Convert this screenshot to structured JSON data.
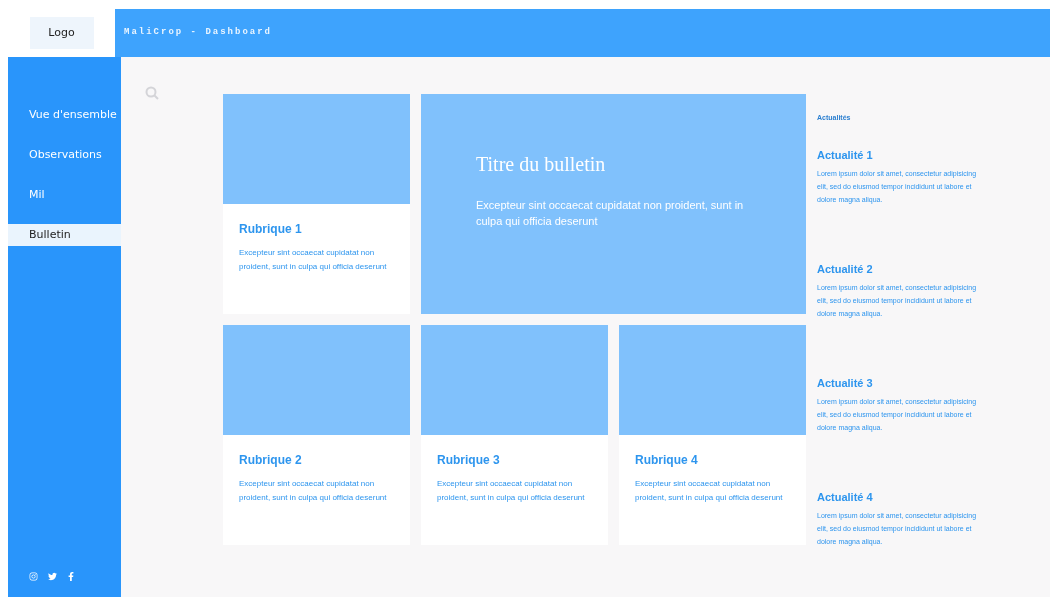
{
  "logo": "Logo",
  "header": {
    "title": "MaliCrop - Dashboard"
  },
  "sidebar": {
    "items": [
      {
        "label": "Vue d'ensemble",
        "selected": false
      },
      {
        "label": "Observations",
        "selected": false
      },
      {
        "label": "Mil",
        "selected": false
      },
      {
        "label": "Bulletin",
        "selected": true
      }
    ]
  },
  "bulletin": {
    "title": "Titre du bulletin",
    "text": "Excepteur sint occaecat cupidatat non proident, sunt in culpa qui officia deserunt"
  },
  "rubriques": [
    {
      "title": "Rubrique 1",
      "text": "Excepteur sint occaecat cupidatat non proident, sunt in culpa qui officia deserunt"
    },
    {
      "title": "Rubrique 2",
      "text": "Excepteur sint occaecat cupidatat non proident, sunt in culpa qui officia deserunt"
    },
    {
      "title": "Rubrique 3",
      "text": "Excepteur sint occaecat cupidatat non proident, sunt in culpa qui officia deserunt"
    },
    {
      "title": "Rubrique 4",
      "text": "Excepteur sint occaecat cupidatat non proident, sunt in culpa qui officia deserunt"
    }
  ],
  "news": {
    "heading": "Actualités",
    "items": [
      {
        "title": "Actualité 1",
        "text": "Lorem ipsum dolor sit amet, consectetur adipisicing elit, sed do eiusmod tempor incididunt ut labore et dolore magna aliqua."
      },
      {
        "title": "Actualité 2",
        "text": "Lorem ipsum dolor sit amet, consectetur adipisicing elit, sed do eiusmod tempor incididunt ut labore et dolore magna aliqua."
      },
      {
        "title": "Actualité 3",
        "text": "Lorem ipsum dolor sit amet, consectetur adipisicing elit, sed do eiusmod tempor incididunt ut labore et dolore magna aliqua."
      },
      {
        "title": "Actualité 4",
        "text": "Lorem ipsum dolor sit amet, consectetur adipisicing elit, sed do eiusmod tempor incididunt ut labore et dolore magna aliqua."
      }
    ]
  }
}
